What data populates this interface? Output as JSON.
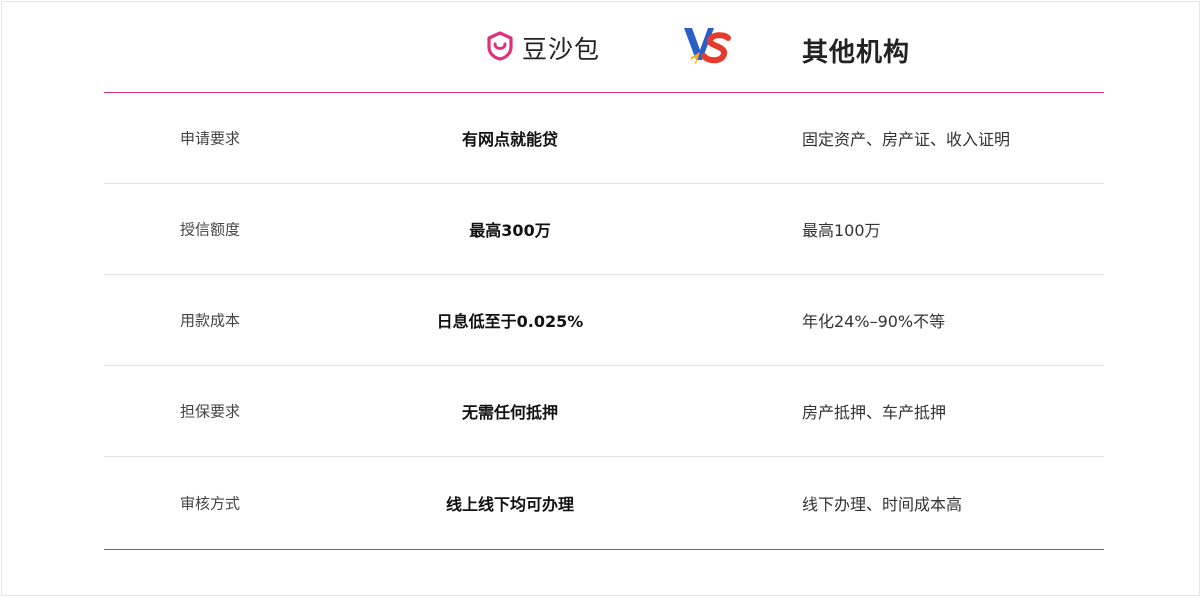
{
  "header": {
    "brand_name": "豆沙包",
    "vs_icon": "vs-badge-icon",
    "other_title": "其他机构"
  },
  "rows": [
    {
      "label": "申请要求",
      "ours": "有网点就能贷",
      "theirs": "固定资产、房产证、收入证明"
    },
    {
      "label": "授信额度",
      "ours": "最高300万",
      "theirs": "最高100万"
    },
    {
      "label": "用款成本",
      "ours": "日息低至于0.025%",
      "theirs": "年化24%–90%不等"
    },
    {
      "label": "担保要求",
      "ours": "无需任何抵押",
      "theirs": "房产抵押、车产抵押"
    },
    {
      "label": "审核方式",
      "ours": "线上线下均可办理",
      "theirs": "线下办理、时间成本高"
    }
  ],
  "colors": {
    "accent": "#e1307a",
    "divider": "#e1e1e1",
    "vs_blue": "#2b5fc7",
    "vs_red": "#e63a2a"
  }
}
